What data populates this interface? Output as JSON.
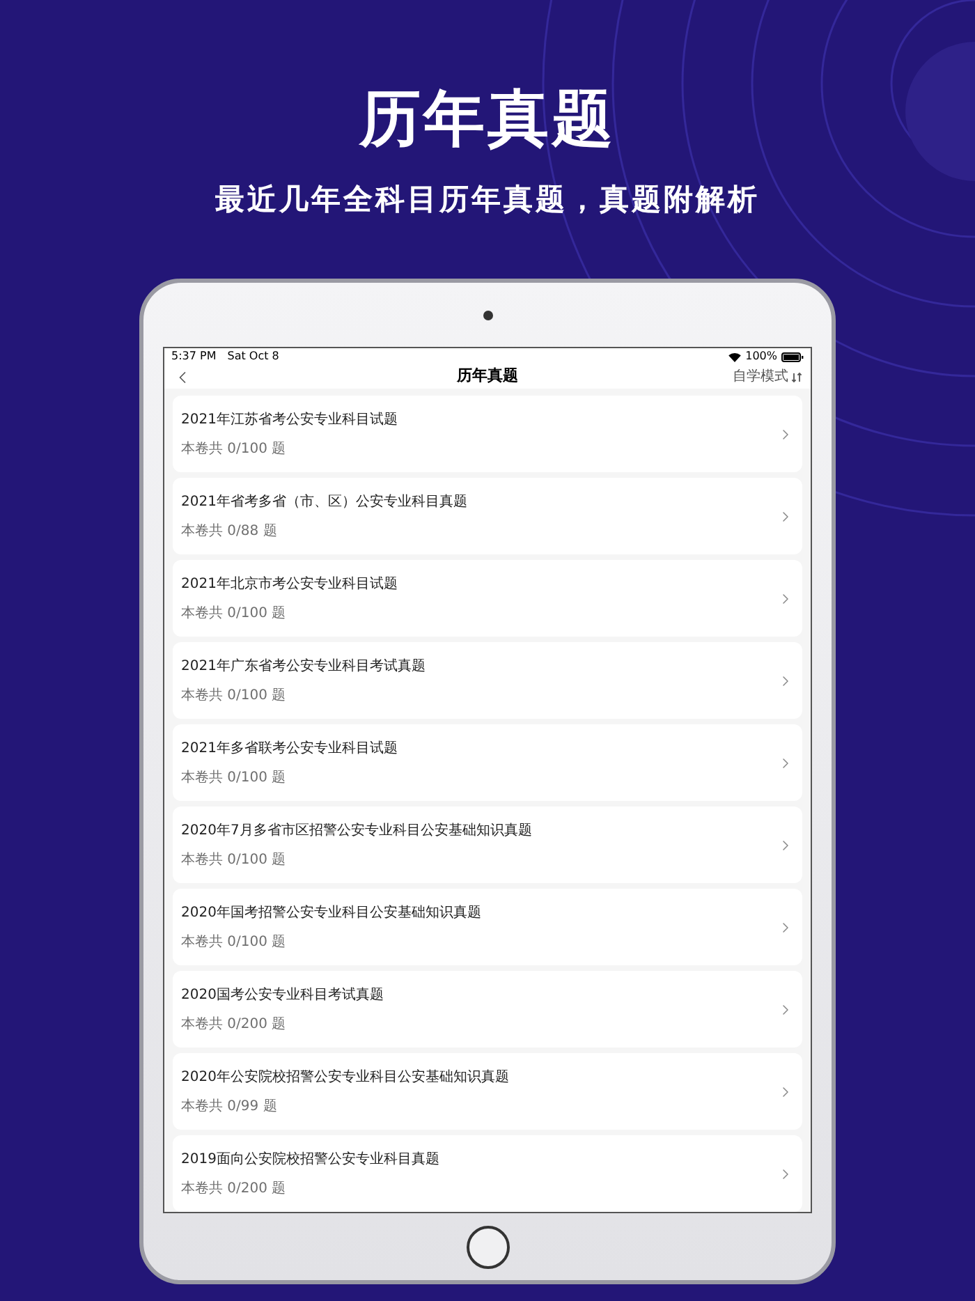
{
  "headline": "历年真题",
  "tagline": "最近几年全科目历年真题，真题附解析",
  "status_bar": {
    "time": "5:37 PM",
    "date": "Sat Oct 8",
    "battery": "100%"
  },
  "nav": {
    "title": "历年真题",
    "mode_button": "自学模式"
  },
  "papers": [
    {
      "title": "2021年江苏省考公安专业科目试题",
      "progress": "本卷共 0/100 题"
    },
    {
      "title": "2021年省考多省（市、区）公安专业科目真题",
      "progress": "本卷共 0/88 题"
    },
    {
      "title": "2021年北京市考公安专业科目试题",
      "progress": "本卷共 0/100 题"
    },
    {
      "title": "2021年广东省考公安专业科目考试真题",
      "progress": "本卷共 0/100 题"
    },
    {
      "title": "2021年多省联考公安专业科目试题",
      "progress": "本卷共 0/100 题"
    },
    {
      "title": "2020年7月多省市区招警公安专业科目公安基础知识真题",
      "progress": "本卷共 0/100 题"
    },
    {
      "title": "2020年国考招警公安专业科目公安基础知识真题",
      "progress": "本卷共 0/100 题"
    },
    {
      "title": "2020国考公安专业科目考试真题",
      "progress": "本卷共 0/200 题"
    },
    {
      "title": "2020年公安院校招警公安专业科目公安基础知识真题",
      "progress": "本卷共 0/99 题"
    },
    {
      "title": "2019面向公安院校招警公安专业科目真题",
      "progress": "本卷共 0/200 题"
    }
  ]
}
